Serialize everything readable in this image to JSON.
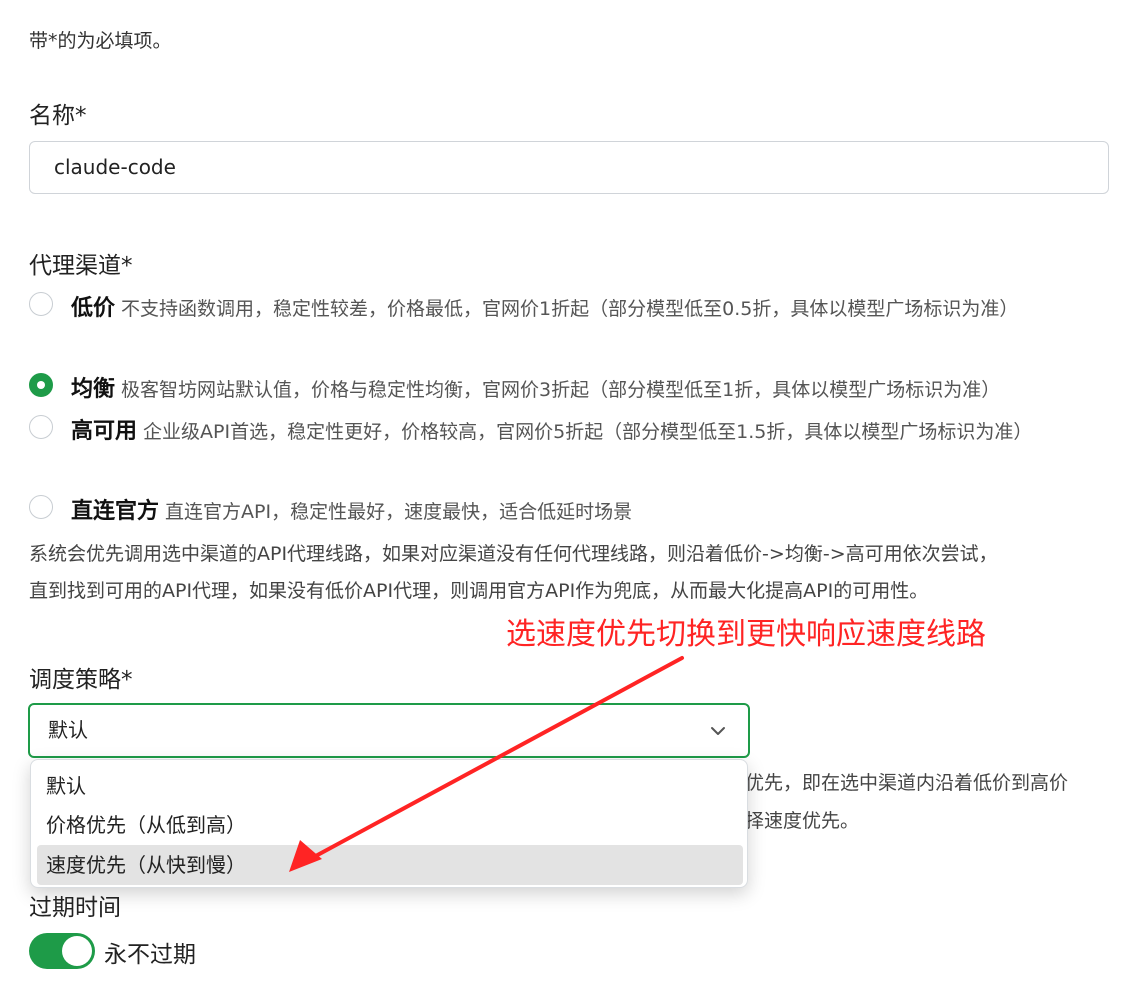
{
  "hint": "带*的为必填项。",
  "name_field": {
    "label": "名称*",
    "value": "claude-code"
  },
  "channel": {
    "label": "代理渠道*",
    "options": [
      {
        "title": "低价",
        "desc": "不支持函数调用，稳定性较差，价格最低，官网价1折起（部分模型低至0.5折，具体以模型广场标识为准）",
        "checked": false
      },
      {
        "title": "均衡",
        "desc": "极客智坊网站默认值，价格与稳定性均衡，官网价3折起（部分模型低至1折，具体以模型广场标识为准）",
        "checked": true
      },
      {
        "title": "高可用",
        "desc": "企业级API首选，稳定性更好，价格较高，官网价5折起（部分模型低至1.5折，具体以模型广场标识为准）",
        "checked": false
      },
      {
        "title": "直连官方",
        "desc": "直连官方API，稳定性最好，速度最快，适合低延时场景",
        "checked": false
      }
    ],
    "info_line1": "系统会优先调用选中渠道的API代理线路，如果对应渠道没有任何代理线路，则沿着低价->均衡->高可用依次尝试，",
    "info_line2": "直到找到可用的API代理，如果没有低价API代理，则调用官方API作为兜底，从而最大化提高API的可用性。"
  },
  "annotation": "选速度优先切换到更快响应速度线路",
  "strategy": {
    "label": "调度策略*",
    "selected": "默认",
    "options": [
      "默认",
      "价格优先（从低到高）",
      "速度优先（从快到慢）"
    ],
    "behind_line1": "优先，即在选中渠道内沿着低价到高价",
    "behind_line2": "择速度优先。"
  },
  "expiry": {
    "label": "过期时间",
    "toggle_label": "永不过期",
    "enabled": true
  },
  "colors": {
    "accent": "#1e9b48",
    "annotation": "#ff2424"
  }
}
